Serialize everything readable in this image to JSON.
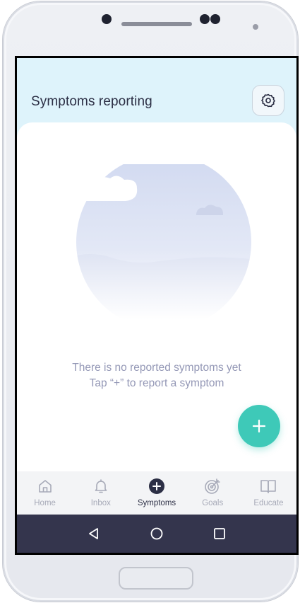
{
  "header": {
    "title": "Symptoms reporting"
  },
  "empty_state": {
    "line1": "There is no reported symptoms yet",
    "line2": "Tap “+” to report a symptom"
  },
  "fab": {
    "icon": "plus-icon"
  },
  "tabs": [
    {
      "label": "Home",
      "icon": "home-icon",
      "active": false
    },
    {
      "label": "Inbox",
      "icon": "bell-icon",
      "active": false
    },
    {
      "label": "Symptoms",
      "icon": "plus-circle-icon",
      "active": true
    },
    {
      "label": "Goals",
      "icon": "target-icon",
      "active": false
    },
    {
      "label": "Educate",
      "icon": "book-icon",
      "active": false
    }
  ],
  "system_nav": [
    "back-icon",
    "home-circle-icon",
    "recents-icon"
  ],
  "colors": {
    "header_bg": "#def3fb",
    "accent": "#3ec9b8",
    "title_text": "#2c2f45",
    "muted_text": "#9498b6",
    "system_nav_bg": "#34354d"
  }
}
